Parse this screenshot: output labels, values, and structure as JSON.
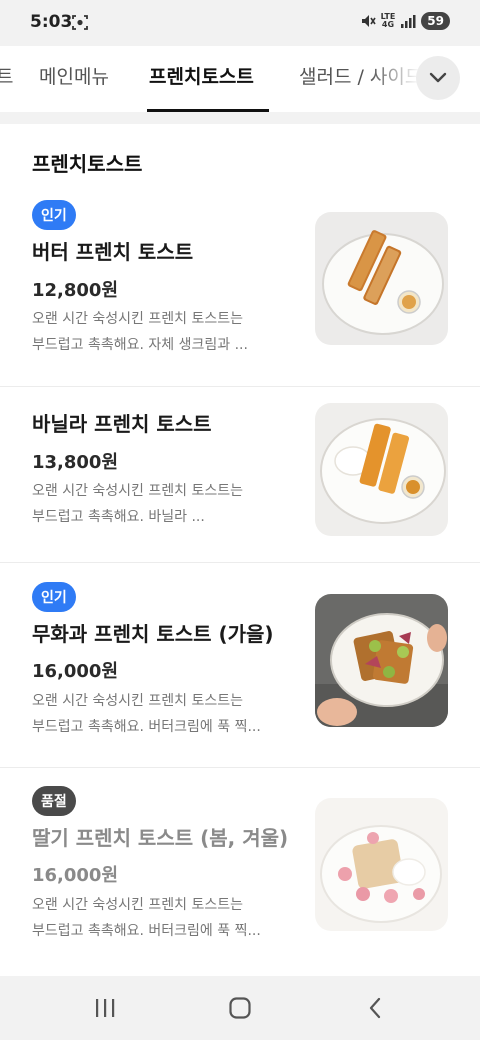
{
  "status_bar": {
    "time": "5:03",
    "network": [
      "LTE",
      "4G"
    ],
    "battery": "59"
  },
  "tabs": [
    {
      "label": "트",
      "active": false
    },
    {
      "label": "메인메뉴",
      "active": false
    },
    {
      "label": "프렌치토스트",
      "active": true
    },
    {
      "label": "샐러드 / 사이드",
      "active": false
    }
  ],
  "section": {
    "title": "프렌치토스트"
  },
  "items": [
    {
      "badge": "인기",
      "name": "버터 프렌치 토스트",
      "price": "12,800원",
      "desc_line1": "오랜 시간 숙성시킨 프렌치 토스트는",
      "desc_line2": "부드럽고 촉촉해요. 자체 생크림과 ..."
    },
    {
      "badge": "",
      "name": "바닐라 프렌치 토스트",
      "price": "13,800원",
      "desc_line1": "오랜 시간 숙성시킨 프렌치 토스트는",
      "desc_line2": "부드럽고 촉촉해요. 바닐라 ..."
    },
    {
      "badge": "인기",
      "name": "무화과 프렌치 토스트 (가을)",
      "price": "16,000원",
      "desc_line1": "오랜 시간 숙성시킨 프렌치 토스트는",
      "desc_line2": "부드럽고 촉촉해요. 버터크림에 푹 찍..."
    },
    {
      "badge": "품절",
      "name": "딸기 프렌치 토스트 (봄, 겨울)",
      "price": "16,000원",
      "desc_line1": "오랜 시간 숙성시킨 프렌치 토스트는",
      "desc_line2": "부드럽고 촉촉해요. 버터크림에 푹 찍..."
    }
  ],
  "colors": {
    "popular_badge": "#2f7bf5",
    "soldout_badge": "#4a4a4a",
    "text_primary": "#1a1a1a",
    "text_secondary": "#777777"
  },
  "icons": [
    "screen-record-icon",
    "mute-icon",
    "signal-icon",
    "chevron-down-icon",
    "recents-icon",
    "home-icon",
    "back-icon"
  ]
}
